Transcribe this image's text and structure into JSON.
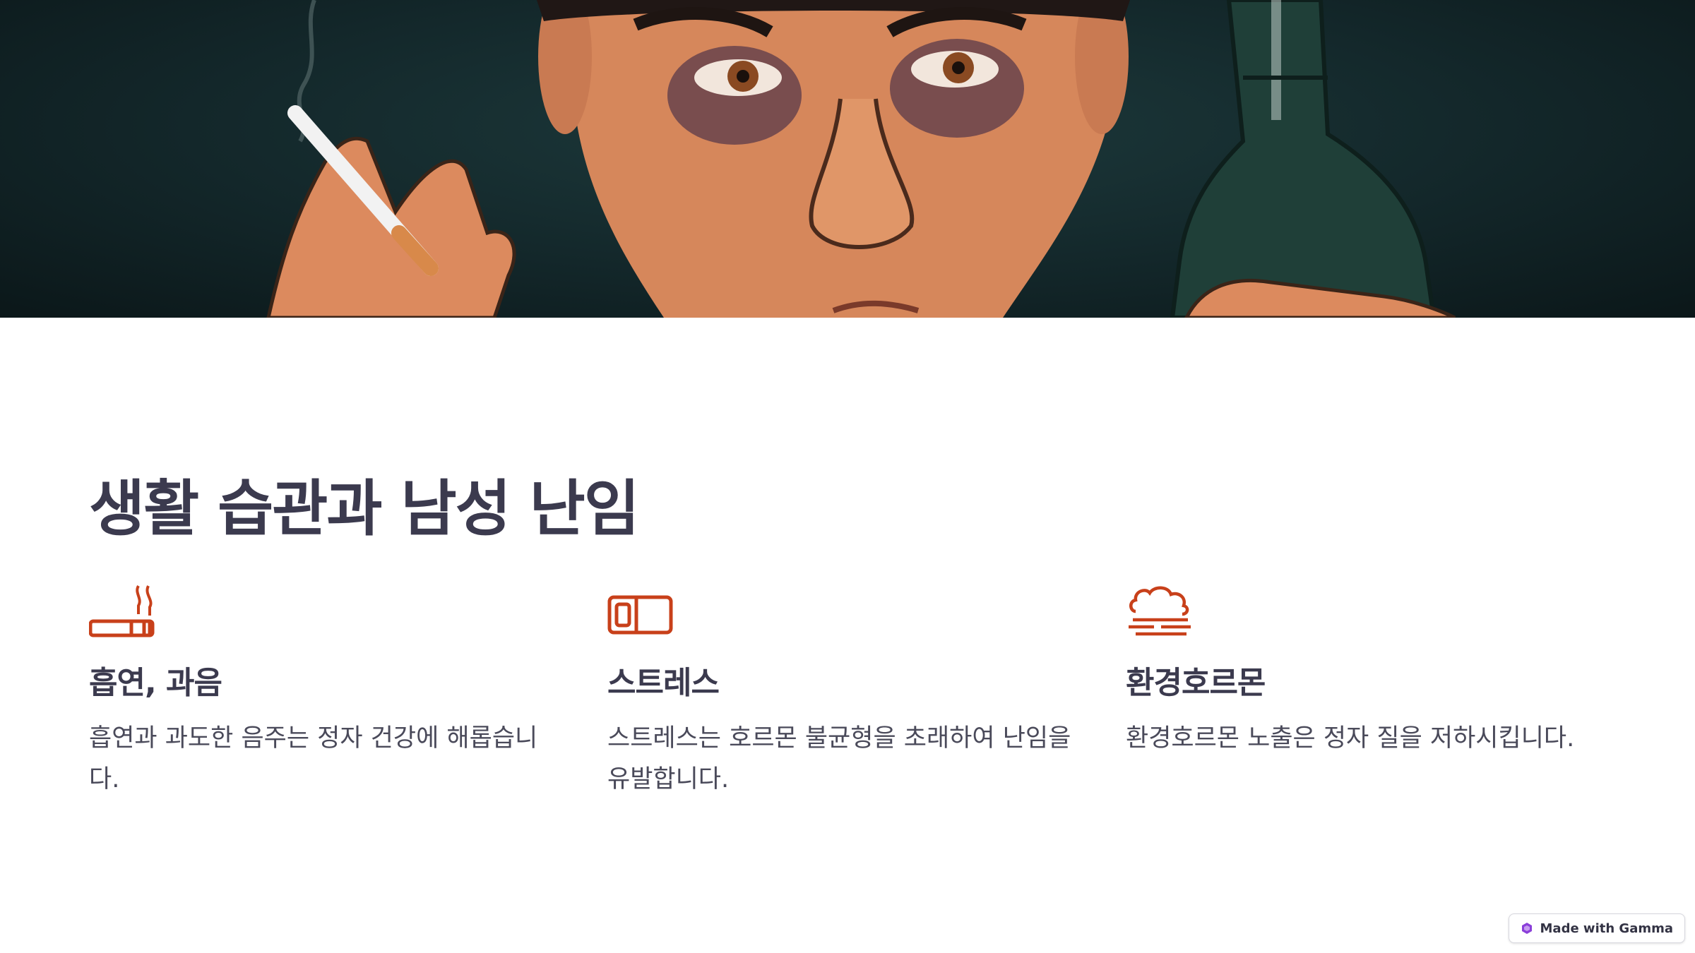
{
  "hero": {
    "image": "man-smoking-drinking-illustration"
  },
  "title": "생활 습관과 남성 난임",
  "accent_color": "#c8401a",
  "cards": [
    {
      "icon": "cigarette-icon",
      "heading": "흡연, 과음",
      "body": "흡연과 과도한 음주는 정자 건강에 해롭습니다."
    },
    {
      "icon": "battery-icon",
      "heading": "스트레스",
      "body": "스트레스는 호르몬 불균형을 초래하여 난임을 유발합니다."
    },
    {
      "icon": "smog-icon",
      "heading": "환경호르몬",
      "body": "환경호르몬 노출은 정자 질을 저하시킵니다."
    }
  ],
  "badge": {
    "label": "Made with Gamma",
    "icon": "gamma-logo-icon"
  }
}
